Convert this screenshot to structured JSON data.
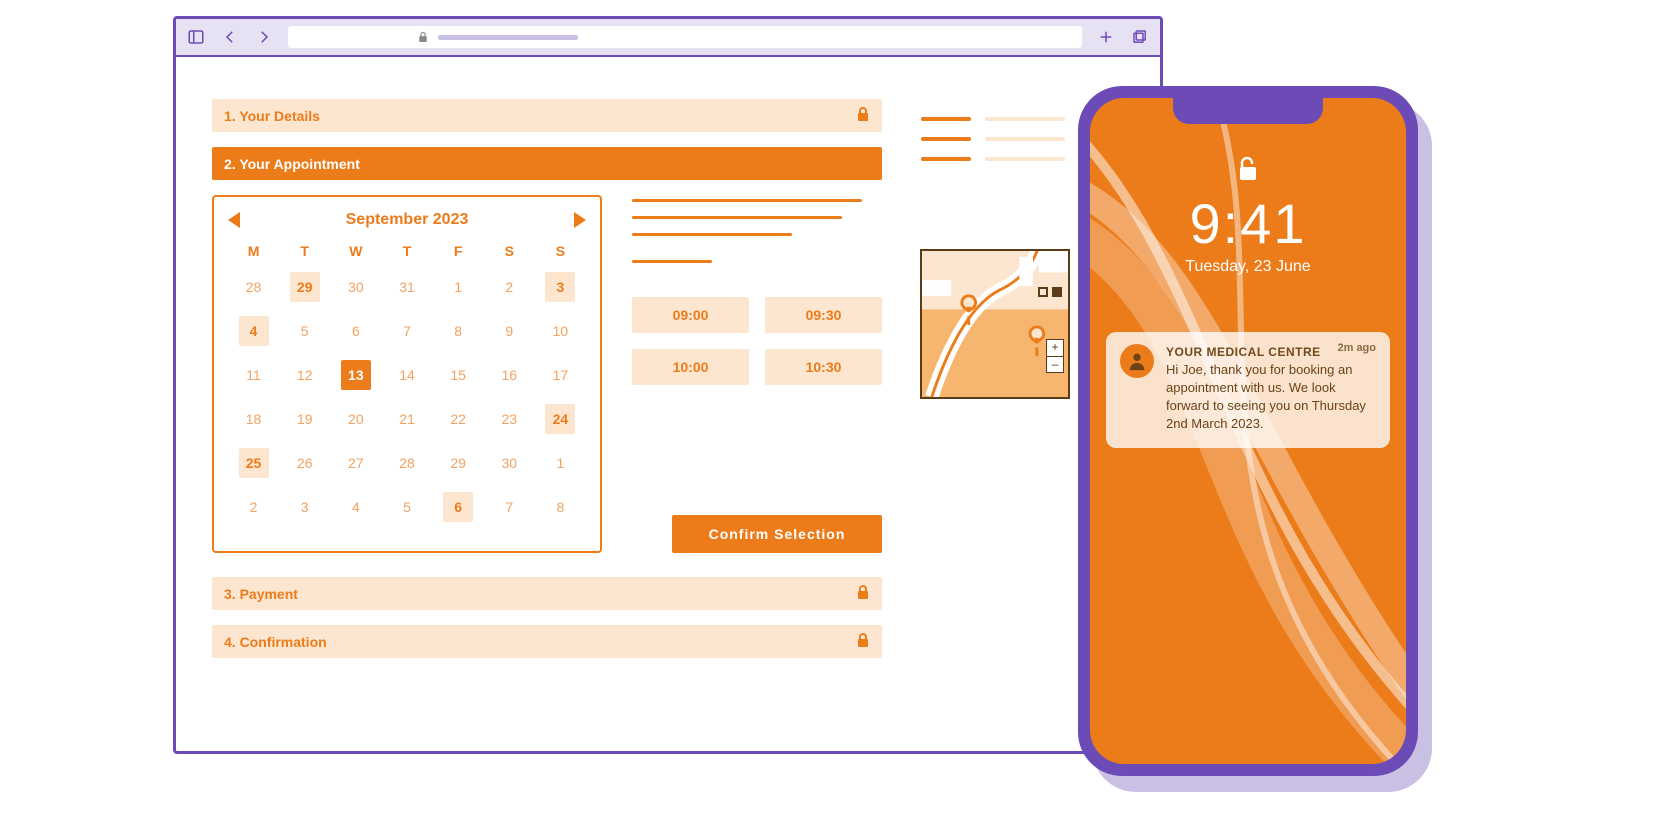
{
  "steps": {
    "s1": "1. Your Details",
    "s2": "2. Your Appointment",
    "s3": "3. Payment",
    "s4": "4. Confirmation"
  },
  "calendar": {
    "month_label": "September 2023",
    "dow": [
      "M",
      "T",
      "W",
      "T",
      "F",
      "S",
      "S"
    ],
    "weeks": [
      [
        {
          "n": "28"
        },
        {
          "n": "29",
          "a": true
        },
        {
          "n": "30"
        },
        {
          "n": "31"
        },
        {
          "n": "1"
        },
        {
          "n": "2"
        },
        {
          "n": "3",
          "a": true
        }
      ],
      [
        {
          "n": "4",
          "a": true
        },
        {
          "n": "5"
        },
        {
          "n": "6"
        },
        {
          "n": "7"
        },
        {
          "n": "8"
        },
        {
          "n": "9"
        },
        {
          "n": "10"
        }
      ],
      [
        {
          "n": "11"
        },
        {
          "n": "12"
        },
        {
          "n": "13",
          "sel": true
        },
        {
          "n": "14"
        },
        {
          "n": "15"
        },
        {
          "n": "16"
        },
        {
          "n": "17"
        }
      ],
      [
        {
          "n": "18"
        },
        {
          "n": "19"
        },
        {
          "n": "20"
        },
        {
          "n": "21"
        },
        {
          "n": "22"
        },
        {
          "n": "23"
        },
        {
          "n": "24",
          "a": true
        }
      ],
      [
        {
          "n": "25",
          "a": true
        },
        {
          "n": "26"
        },
        {
          "n": "27"
        },
        {
          "n": "28"
        },
        {
          "n": "29"
        },
        {
          "n": "30"
        },
        {
          "n": "1"
        }
      ],
      [
        {
          "n": "2"
        },
        {
          "n": "3"
        },
        {
          "n": "4"
        },
        {
          "n": "5"
        },
        {
          "n": "6",
          "a": true
        },
        {
          "n": "7"
        },
        {
          "n": "8"
        }
      ]
    ]
  },
  "slots": [
    "09:00",
    "09:30",
    "10:00",
    "10:30"
  ],
  "confirm_label": "Confirm Selection",
  "map": {
    "zoom_in": "+",
    "zoom_out": "–"
  },
  "phone": {
    "time": "9:41",
    "date": "Tuesday,  23 June",
    "notif_title": "YOUR MEDICAL CENTRE",
    "notif_meta": "2m ago",
    "notif_body": "Hi Joe, thank you for booking an appointment with us. We look forward to seeing you on Thursday 2nd March 2023."
  }
}
